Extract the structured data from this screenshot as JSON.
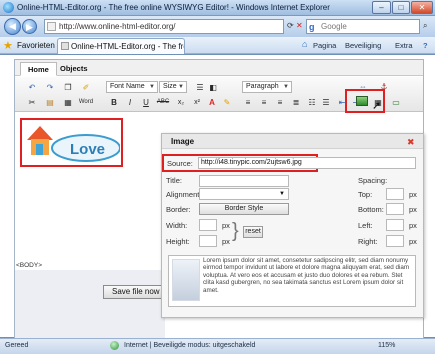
{
  "window": {
    "title": "Online-HTML-Editor.org - The free online WYSIWYG Editor! - Windows Internet Explorer",
    "minimize": "–",
    "maximize": "□",
    "close": "✕"
  },
  "address_bar": {
    "url": "http://www.online-html-editor.org/",
    "search_placeholder": "Google",
    "search_engine_letter": "g"
  },
  "command_bar": {
    "favorites_label": "Favorieten",
    "tab_title": "Online-HTML-Editor.org - The free online ...",
    "home_icon": "home-icon",
    "page_menu": "Pagina",
    "security_menu": "Beveiliging",
    "extra_menu": "Extra",
    "help_menu": "?"
  },
  "editor": {
    "tabs": [
      {
        "label": "Home",
        "active": true
      },
      {
        "label": "Objects",
        "active": false
      }
    ],
    "toolbar": {
      "font_name": "Font Name",
      "size": "Size",
      "paragraph": "Paragraph",
      "rows_icons": {
        "row1": [
          "undo-icon",
          "redo-icon",
          "copy-icon",
          "clear-icon"
        ],
        "row2": [
          "cut-icon",
          "paste-icon",
          "paste-text-icon",
          "paste-word-icon"
        ],
        "format_row": [
          "B",
          "I",
          "U",
          "ABC",
          "x₂",
          "x²",
          "A",
          "✎"
        ],
        "align_row": [
          "align-left-icon",
          "align-center-icon",
          "align-right-icon",
          "align-justify-icon",
          "ordered-list-icon",
          "unordered-list-icon",
          "outdent-icon",
          "indent-icon"
        ]
      },
      "paste_word_label": "Word"
    },
    "content": {
      "logo_text": "Love",
      "status_path": "<BODY>"
    },
    "save_button": "Save file now"
  },
  "image_dialog": {
    "title": "Image",
    "source_label": "Source:",
    "source_value": "http://i48.tinypic.com/2ujtsw6.jpg",
    "title_label": "Title:",
    "alignment_label": "Alignment:",
    "border_label": "Border:",
    "border_style_button": "Border Style",
    "width_label": "Width:",
    "height_label": "Height:",
    "px": "px",
    "reset_button": "reset",
    "spacing_label": "Spacing:",
    "top_label": "Top:",
    "bottom_label": "Bottom:",
    "left_label": "Left:",
    "right_label": "Right:",
    "preview_text": "Lorem ipsum dolor sit amet, consetetur sadipscing elitr, sed diam nonumy eirmod tempor invidunt ut labore et dolore magna aliquyam erat, sed diam voluptua. At vero eos et accusam et justo duo dolores et ea rebum. Stet clita kasd gubergren, no sea takimata sanctus est Lorem ipsum dolor sit amet."
  },
  "statusbar": {
    "left": "Gereed",
    "zone": "Internet | Beveiligde modus: uitgeschakeld",
    "zoom": "115%"
  },
  "colors": {
    "highlight": "#e02020",
    "window_blue": "#9fbde0"
  }
}
